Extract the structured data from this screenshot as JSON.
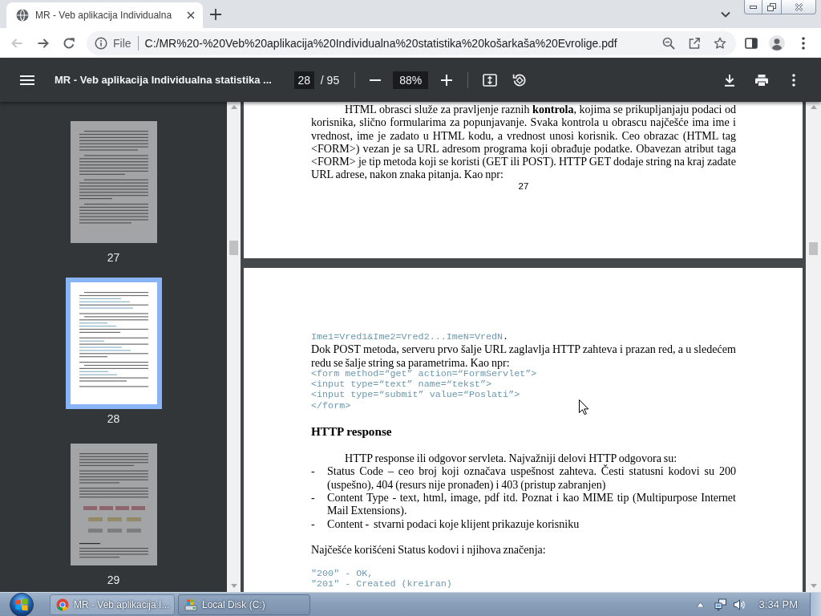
{
  "window": {
    "tabs": [
      {
        "title": "MR - Veb aplikacija Individualna",
        "selected": true
      }
    ]
  },
  "toolbar": {
    "nav_buttons": [
      {
        "kind": "back",
        "disabled": true
      },
      {
        "kind": "forward",
        "disabled": false
      },
      {
        "kind": "reload",
        "disabled": false
      }
    ],
    "address": {
      "scheme": "File",
      "url": "C:/MR%20-%20Veb%20aplikacija%20Individualna%20statistika%20košarkaša%20Evrolige.pdf"
    }
  },
  "pdf_toolbar": {
    "title": "MR - Veb aplikacija Individualna statistika ...",
    "page": "28",
    "page_total": "/ 95",
    "zoom": "88%"
  },
  "sidebar": {
    "thumbnails": [
      {
        "label": "27",
        "kind": "text",
        "selected": false
      },
      {
        "label": "28",
        "kind": "text",
        "selected": true
      },
      {
        "label": "29",
        "kind": "diagram",
        "selected": false
      }
    ]
  },
  "pages": [
    {
      "sections": [
        [
          {
            "kind": "paragraph",
            "indent": true,
            "text": "HTML obrasci služe za pravljenje raznih **kontrola**, kojima se prikupljanjaju podaci od korisnika, slično formularima za popunjavanje. Svaka kontrola u obrascu najčešće ima ime i vrednost, ime je zadato u HTML kodu, a vrednost unosi korisnik. Ceo obrazac (HTML tag <FORM>) vezan je sa URL adresom programa koji obrađuje podatke. Obavezan atribut taga <FORM> je tip metoda koji se koristi (GET ili POST). HTTP GET dodaje string na kraj zadate URL adrese, nakon znaka pitanja. Kao npr:"
          }
        ]
      ],
      "page_number": "27"
    },
    {
      "sections": [
        [
          {
            "kind": "code",
            "text": "Ime1=Vred1&Ime2=Vred2...ImeN=VredN",
            "suffix": "."
          },
          {
            "kind": "paragraph",
            "indent": false,
            "text": "Dok POST metoda, serveru prvo šalje URL zaglavlja HTTP zahteva i prazan red, a u sledećem redu se šalje string sa parametrima. Kao npr:"
          },
          {
            "kind": "code",
            "text": "<form method=“get” action=“FormServlet”>"
          },
          {
            "kind": "code",
            "text": "<input type=“text” name=“tekst”>"
          },
          {
            "kind": "code",
            "text": "<input type=“submit” value=“Poslati”>"
          },
          {
            "kind": "code",
            "text": "</form>"
          }
        ],
        [
          {
            "kind": "heading",
            "text": "HTTP response"
          }
        ],
        [
          {
            "kind": "paragraph",
            "indent": true,
            "text": "HTTP response ili odgovor servleta. Najvažniji delovi HTTP odgovora su:"
          },
          {
            "kind": "list_item",
            "bullet": "-",
            "text": "Status Code – ceo broj koji označava uspešnost zahteva. Česti statusni kodovi su 200 (uspešno), 404 (resurs nije pronađen) i 403 (pristup zabranjen)"
          },
          {
            "kind": "list_item",
            "bullet": "-",
            "text": "Content Type - text, html, image, pdf itd. Poznat i kao MIME tip (Multipurpose Internet Mail Extensions)."
          },
          {
            "kind": "list_item",
            "bullet": "-",
            "text": "Content -  stvarni podaci koje klijent prikazuje korisniku"
          }
        ],
        [
          {
            "kind": "paragraph",
            "indent": false,
            "text": "Najčešće korišćeni Status kodovi i njihova značenja:"
          }
        ],
        [
          {
            "kind": "code",
            "text": "\"200\" - OK,"
          },
          {
            "kind": "code",
            "text": "\"201\" - Created (kreiran)"
          }
        ]
      ]
    }
  ],
  "taskbar": {
    "items": [
      {
        "kind": "browser",
        "label": "MR - Veb aplikacija I...",
        "selected": true
      },
      {
        "kind": "drive",
        "label": "Local Disk (C:)",
        "selected": false
      }
    ],
    "clock": "3:34 PM"
  }
}
